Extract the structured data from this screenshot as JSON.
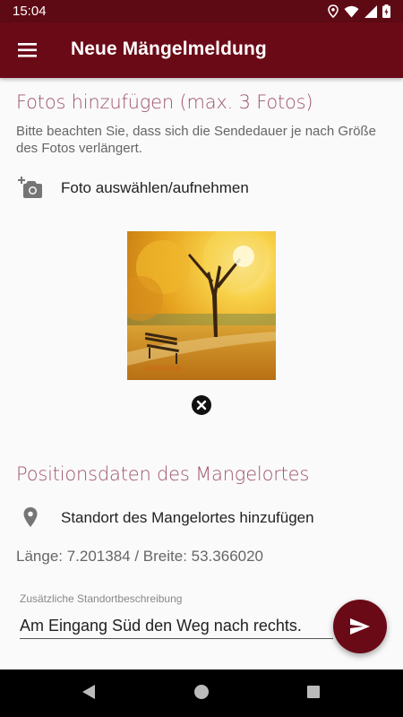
{
  "status_bar": {
    "time": "15:04"
  },
  "app_bar": {
    "title": "Neue Mängelmeldung"
  },
  "photos": {
    "section_title": "Fotos hinzufügen (max. 3 Fotos)",
    "hint": "Bitte beachten Sie, dass sich die Sendedauer je nach Größe des Fotos verlängert.",
    "add_label": "Foto auswählen/aufnehmen"
  },
  "position": {
    "section_title": "Positionsdaten des Mangelortes",
    "add_location_label": "Standort des Mangelortes hinzufügen",
    "coordinates": "Länge: 7.201384 / Breite: 53.366020"
  },
  "location_description": {
    "label": "Zusätzliche Standortbeschreibung",
    "value": "Am Eingang Süd den Weg nach rechts."
  },
  "icons": {
    "menu": "hamburger-menu-icon",
    "add_photo": "add-photo-camera-icon",
    "remove": "close-circle-icon",
    "location": "location-pin-icon",
    "send": "send-icon"
  },
  "colors": {
    "primary": "#6b0a17",
    "status_bar": "#5e0a14",
    "section_title": "#a0566c"
  }
}
